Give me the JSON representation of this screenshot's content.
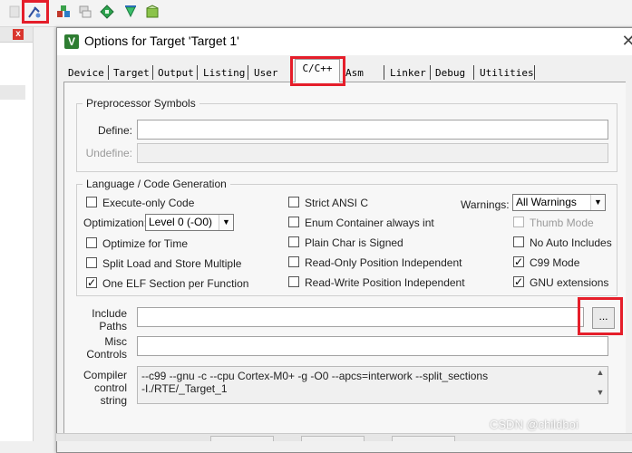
{
  "dialog": {
    "title": "Options for Target 'Target 1'",
    "icon": "keil-logo-icon"
  },
  "tabs": [
    {
      "label": "Device"
    },
    {
      "label": "Target"
    },
    {
      "label": "Output"
    },
    {
      "label": "Listing"
    },
    {
      "label": "User"
    },
    {
      "label": "C/C++",
      "active": true
    },
    {
      "label": "Asm"
    },
    {
      "label": "Linker"
    },
    {
      "label": "Debug"
    },
    {
      "label": "Utilities"
    }
  ],
  "preprocessor": {
    "legend": "Preprocessor Symbols",
    "define_label": "Define:",
    "define_value": "",
    "undefine_label": "Undefine:",
    "undefine_value": ""
  },
  "language": {
    "legend": "Language / Code Generation",
    "execute_only": {
      "label": "Execute-only Code",
      "checked": false
    },
    "optimization_label": "Optimization:",
    "optimization_value": "Level 0 (-O0)",
    "optimize_time": {
      "label": "Optimize for Time",
      "checked": false
    },
    "split_load": {
      "label": "Split Load and Store Multiple",
      "checked": false
    },
    "one_elf": {
      "label": "One ELF Section per Function",
      "checked": true
    },
    "strict_ansi": {
      "label": "Strict ANSI C",
      "checked": false
    },
    "enum_container": {
      "label": "Enum Container always int",
      "checked": false
    },
    "plain_char": {
      "label": "Plain Char is Signed",
      "checked": false
    },
    "ro_pi": {
      "label": "Read-Only Position Independent",
      "checked": false
    },
    "rw_pi": {
      "label": "Read-Write Position Independent",
      "checked": false
    },
    "warnings_label": "Warnings:",
    "warnings_value": "All Warnings",
    "thumb_mode": {
      "label": "Thumb Mode",
      "checked": false,
      "disabled": true
    },
    "no_auto_includes": {
      "label": "No Auto Includes",
      "checked": false
    },
    "c99_mode": {
      "label": "C99 Mode",
      "checked": true
    },
    "gnu_ext": {
      "label": "GNU extensions",
      "checked": true
    }
  },
  "paths": {
    "include_label_1": "Include",
    "include_label_2": "Paths",
    "include_value": "",
    "browse_label": "...",
    "misc_label_1": "Misc",
    "misc_label_2": "Controls",
    "misc_value": ""
  },
  "compiler": {
    "label_1": "Compiler",
    "label_2": "control",
    "label_3": "string",
    "line_1": "--c99 --gnu -c --cpu Cortex-M0+ -g -O0 --apcs=interwork --split_sections",
    "line_2": "-I./RTE/_Target_1"
  },
  "ide": {
    "side_close": "x"
  },
  "watermark": "CSDN @childboi",
  "colors": {
    "highlight_red": "#e51e2a",
    "title_icon_green": "#2e7d32"
  }
}
